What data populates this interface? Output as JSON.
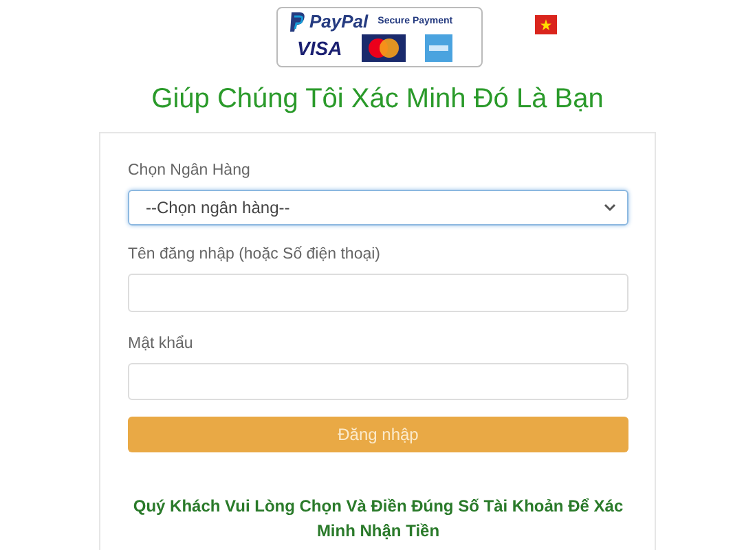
{
  "badge": {
    "brand": "PayPal",
    "tagline": "Secure Payment",
    "cards": [
      "VISA"
    ]
  },
  "title": "Giúp Chúng Tôi Xác Minh Đó Là Bạn",
  "form": {
    "bank_label": "Chọn Ngân Hàng",
    "bank_select": "--Chọn ngân hàng--",
    "username_label": "Tên đăng nhập (hoặc Số điện thoại)",
    "password_label": "Mật khẩu",
    "submit": "Đăng nhập"
  },
  "notice": "Quý Khách Vui Lòng Chọn Và Điền Đúng Số Tài Khoản Để Xác Minh Nhận Tiền"
}
